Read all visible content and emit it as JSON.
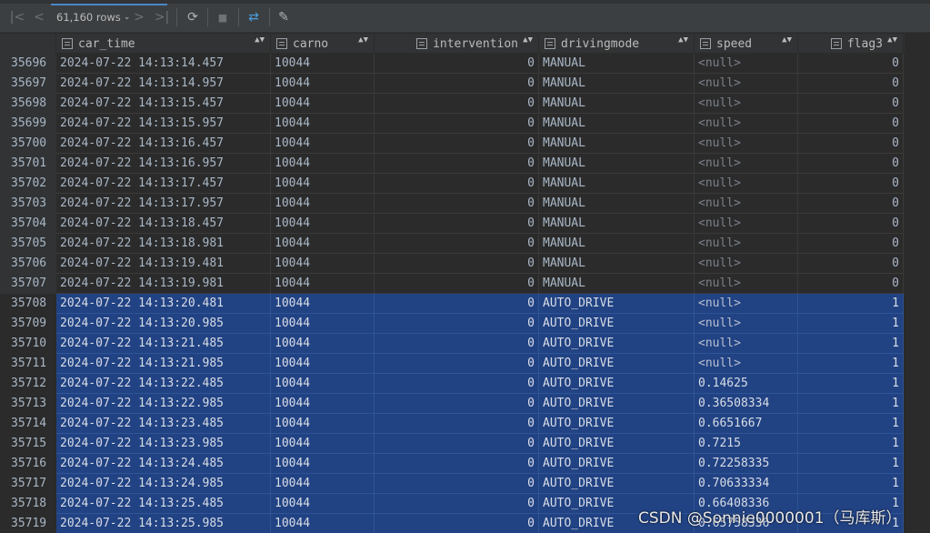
{
  "toolbar": {
    "rows_label": "61,160 rows",
    "buttons": [
      {
        "name": "first-page-icon",
        "glyph": "|<"
      },
      {
        "name": "prev-page-icon",
        "glyph": "<"
      },
      {
        "name": "next-page-icon",
        "glyph": ">"
      },
      {
        "name": "last-page-icon",
        "glyph": ">|"
      },
      {
        "name": "refresh-icon",
        "glyph": "⟳"
      },
      {
        "name": "stop-icon",
        "glyph": "■"
      },
      {
        "name": "compare-icon",
        "glyph": "⇄"
      },
      {
        "name": "pin-icon",
        "glyph": "✎"
      }
    ],
    "chevron": "⌄"
  },
  "columns": [
    {
      "key": "car_time",
      "label": "car_time"
    },
    {
      "key": "carno",
      "label": "carno"
    },
    {
      "key": "intervention",
      "label": "intervention"
    },
    {
      "key": "drivingmode",
      "label": "drivingmode"
    },
    {
      "key": "speed",
      "label": "speed"
    },
    {
      "key": "flag3",
      "label": "flag3"
    }
  ],
  "sort_glyph": "▲▼",
  "rows": [
    {
      "n": "35696",
      "car_time": "2024-07-22 14:13:14.457",
      "carno": "10044",
      "intervention": "0",
      "drivingmode": "MANUAL",
      "speed": "<null>",
      "flag3": "0",
      "selected": false
    },
    {
      "n": "35697",
      "car_time": "2024-07-22 14:13:14.957",
      "carno": "10044",
      "intervention": "0",
      "drivingmode": "MANUAL",
      "speed": "<null>",
      "flag3": "0",
      "selected": false
    },
    {
      "n": "35698",
      "car_time": "2024-07-22 14:13:15.457",
      "carno": "10044",
      "intervention": "0",
      "drivingmode": "MANUAL",
      "speed": "<null>",
      "flag3": "0",
      "selected": false
    },
    {
      "n": "35699",
      "car_time": "2024-07-22 14:13:15.957",
      "carno": "10044",
      "intervention": "0",
      "drivingmode": "MANUAL",
      "speed": "<null>",
      "flag3": "0",
      "selected": false
    },
    {
      "n": "35700",
      "car_time": "2024-07-22 14:13:16.457",
      "carno": "10044",
      "intervention": "0",
      "drivingmode": "MANUAL",
      "speed": "<null>",
      "flag3": "0",
      "selected": false
    },
    {
      "n": "35701",
      "car_time": "2024-07-22 14:13:16.957",
      "carno": "10044",
      "intervention": "0",
      "drivingmode": "MANUAL",
      "speed": "<null>",
      "flag3": "0",
      "selected": false
    },
    {
      "n": "35702",
      "car_time": "2024-07-22 14:13:17.457",
      "carno": "10044",
      "intervention": "0",
      "drivingmode": "MANUAL",
      "speed": "<null>",
      "flag3": "0",
      "selected": false
    },
    {
      "n": "35703",
      "car_time": "2024-07-22 14:13:17.957",
      "carno": "10044",
      "intervention": "0",
      "drivingmode": "MANUAL",
      "speed": "<null>",
      "flag3": "0",
      "selected": false
    },
    {
      "n": "35704",
      "car_time": "2024-07-22 14:13:18.457",
      "carno": "10044",
      "intervention": "0",
      "drivingmode": "MANUAL",
      "speed": "<null>",
      "flag3": "0",
      "selected": false
    },
    {
      "n": "35705",
      "car_time": "2024-07-22 14:13:18.981",
      "carno": "10044",
      "intervention": "0",
      "drivingmode": "MANUAL",
      "speed": "<null>",
      "flag3": "0",
      "selected": false
    },
    {
      "n": "35706",
      "car_time": "2024-07-22 14:13:19.481",
      "carno": "10044",
      "intervention": "0",
      "drivingmode": "MANUAL",
      "speed": "<null>",
      "flag3": "0",
      "selected": false
    },
    {
      "n": "35707",
      "car_time": "2024-07-22 14:13:19.981",
      "carno": "10044",
      "intervention": "0",
      "drivingmode": "MANUAL",
      "speed": "<null>",
      "flag3": "0",
      "selected": false
    },
    {
      "n": "35708",
      "car_time": "2024-07-22 14:13:20.481",
      "carno": "10044",
      "intervention": "0",
      "drivingmode": "AUTO_DRIVE",
      "speed": "<null>",
      "flag3": "1",
      "selected": true
    },
    {
      "n": "35709",
      "car_time": "2024-07-22 14:13:20.985",
      "carno": "10044",
      "intervention": "0",
      "drivingmode": "AUTO_DRIVE",
      "speed": "<null>",
      "flag3": "1",
      "selected": true
    },
    {
      "n": "35710",
      "car_time": "2024-07-22 14:13:21.485",
      "carno": "10044",
      "intervention": "0",
      "drivingmode": "AUTO_DRIVE",
      "speed": "<null>",
      "flag3": "1",
      "selected": true
    },
    {
      "n": "35711",
      "car_time": "2024-07-22 14:13:21.985",
      "carno": "10044",
      "intervention": "0",
      "drivingmode": "AUTO_DRIVE",
      "speed": "<null>",
      "flag3": "1",
      "selected": true
    },
    {
      "n": "35712",
      "car_time": "2024-07-22 14:13:22.485",
      "carno": "10044",
      "intervention": "0",
      "drivingmode": "AUTO_DRIVE",
      "speed": "0.14625",
      "flag3": "1",
      "selected": true
    },
    {
      "n": "35713",
      "car_time": "2024-07-22 14:13:22.985",
      "carno": "10044",
      "intervention": "0",
      "drivingmode": "AUTO_DRIVE",
      "speed": "0.36508334",
      "flag3": "1",
      "selected": true
    },
    {
      "n": "35714",
      "car_time": "2024-07-22 14:13:23.485",
      "carno": "10044",
      "intervention": "0",
      "drivingmode": "AUTO_DRIVE",
      "speed": "0.6651667",
      "flag3": "1",
      "selected": true
    },
    {
      "n": "35715",
      "car_time": "2024-07-22 14:13:23.985",
      "carno": "10044",
      "intervention": "0",
      "drivingmode": "AUTO_DRIVE",
      "speed": "0.7215",
      "flag3": "1",
      "selected": true
    },
    {
      "n": "35716",
      "car_time": "2024-07-22 14:13:24.485",
      "carno": "10044",
      "intervention": "0",
      "drivingmode": "AUTO_DRIVE",
      "speed": "0.72258335",
      "flag3": "1",
      "selected": true
    },
    {
      "n": "35717",
      "car_time": "2024-07-22 14:13:24.985",
      "carno": "10044",
      "intervention": "0",
      "drivingmode": "AUTO_DRIVE",
      "speed": "0.70633334",
      "flag3": "1",
      "selected": true
    },
    {
      "n": "35718",
      "car_time": "2024-07-22 14:13:25.485",
      "carno": "10044",
      "intervention": "0",
      "drivingmode": "AUTO_DRIVE",
      "speed": "0.66408336",
      "flag3": "1",
      "selected": true
    },
    {
      "n": "35719",
      "car_time": "2024-07-22 14:13:25.985",
      "carno": "10044",
      "intervention": "0",
      "drivingmode": "AUTO_DRIVE",
      "speed": "0.65758336",
      "flag3": "1",
      "selected": true
    }
  ],
  "watermark": "CSDN @Sonnie0000001（马库斯）",
  "colors": {
    "selection": "#214283",
    "background": "#2b2b2b",
    "header": "#313335",
    "toolbar": "#3c3f41"
  }
}
